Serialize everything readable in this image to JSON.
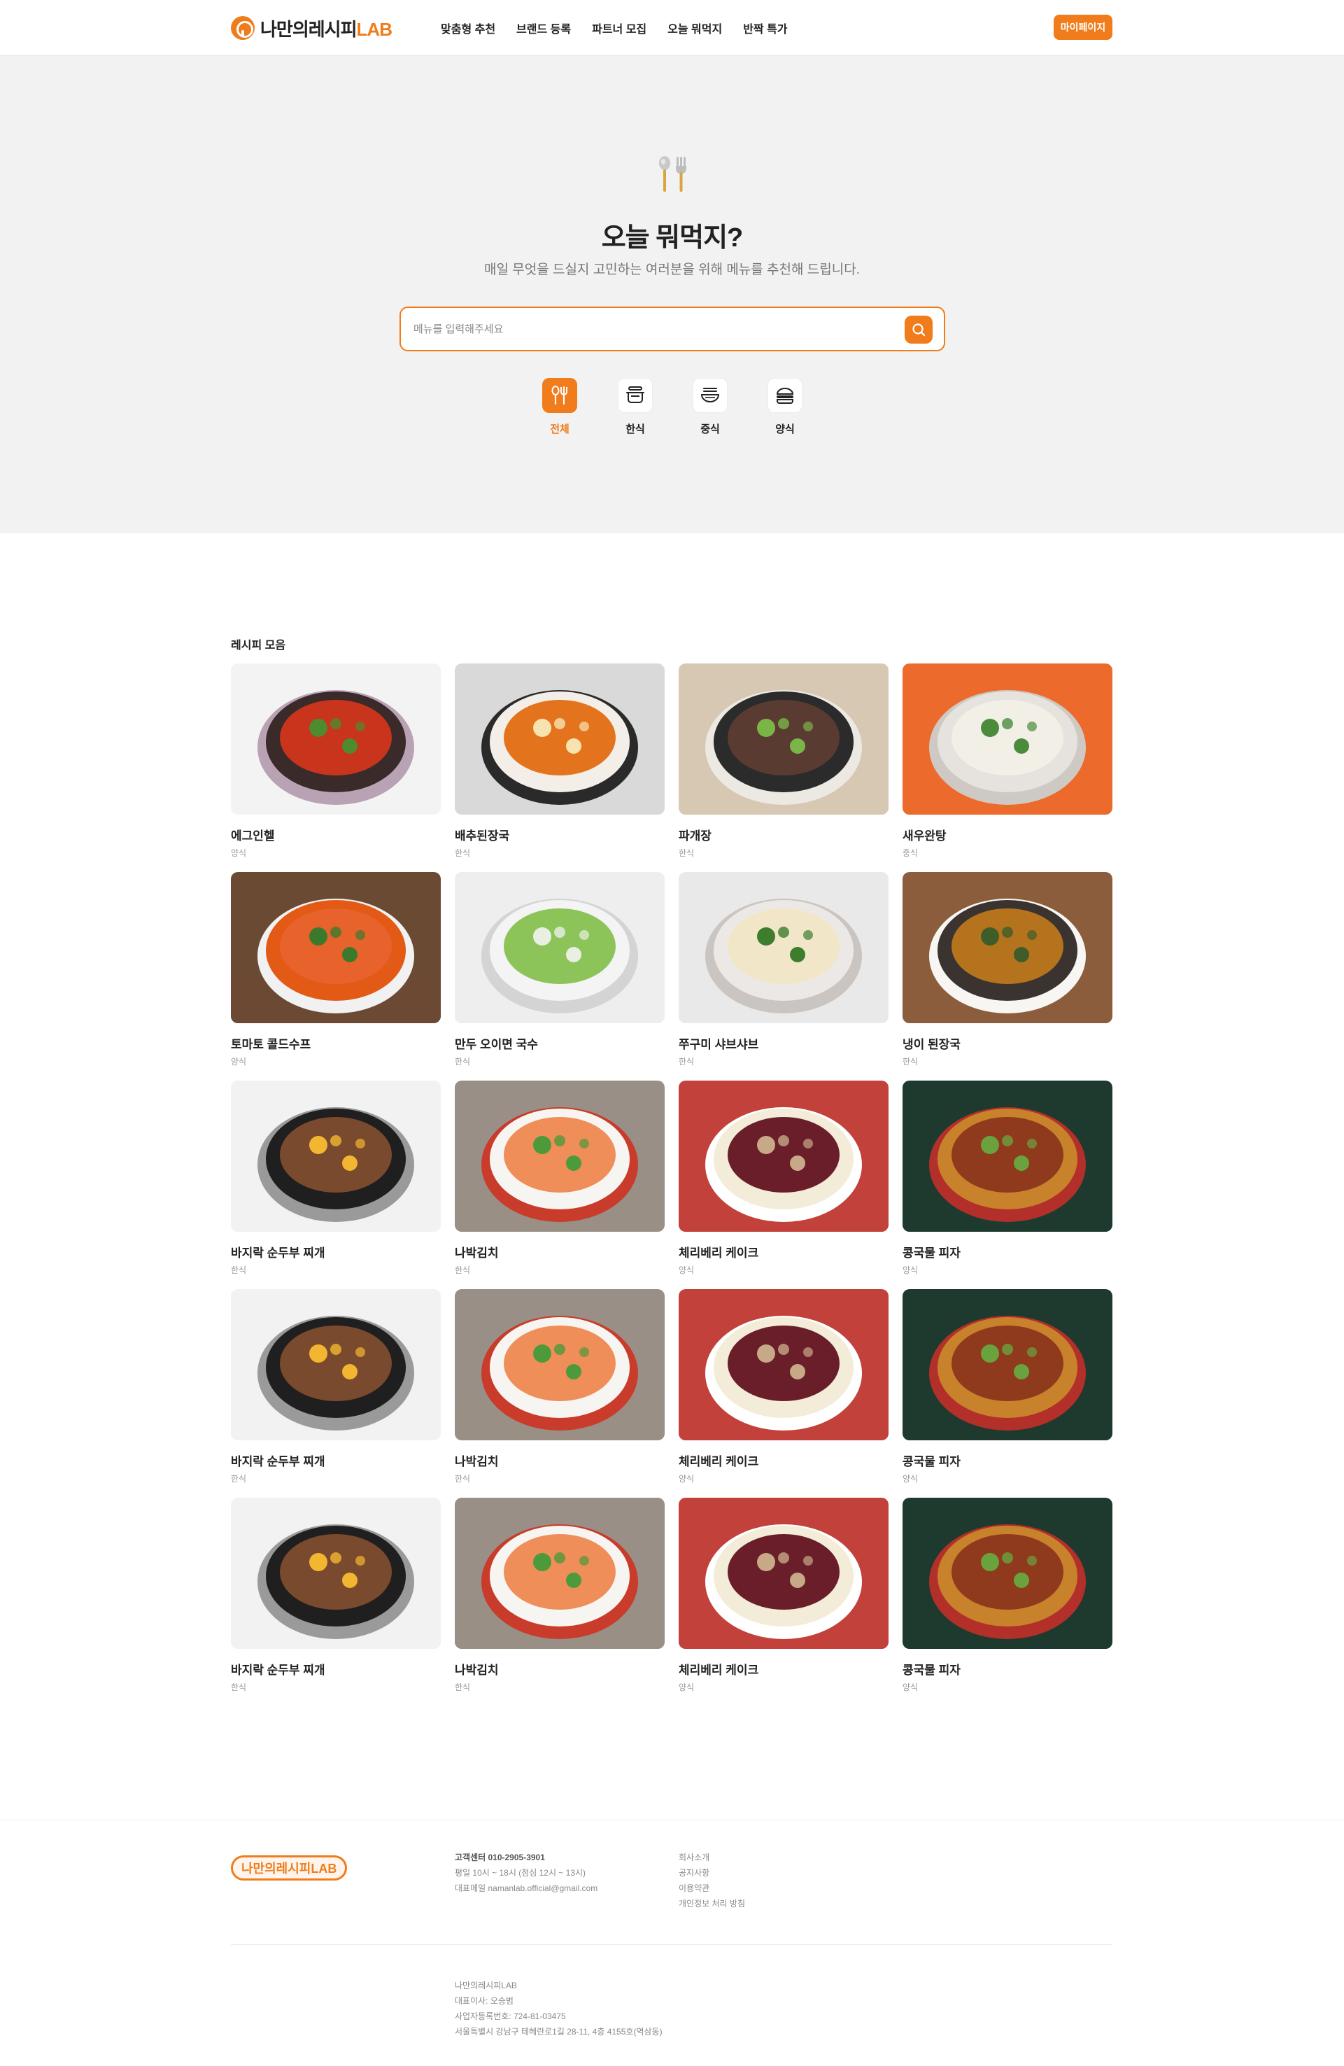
{
  "header": {
    "logo_main": "나만의레시피",
    "logo_lab": "LAB",
    "nav": [
      "맞춤형 추천",
      "브랜드 등록",
      "파트너 모집",
      "오늘 뭐먹지",
      "반짝 특가"
    ],
    "mypage": "마이페이지"
  },
  "hero": {
    "title": "오늘 뭐먹지?",
    "subtitle": "매일 무엇을 드실지 고민하는 여러분을 위해 메뉴를 추천해 드립니다.",
    "search_placeholder": "메뉴를 입력해주세요",
    "categories": [
      {
        "label": "전체",
        "icon": "utensils-icon",
        "active": true
      },
      {
        "label": "한식",
        "icon": "pot-icon",
        "active": false
      },
      {
        "label": "중식",
        "icon": "noodle-bowl-icon",
        "active": false
      },
      {
        "label": "양식",
        "icon": "burger-icon",
        "active": false
      }
    ]
  },
  "recipes": {
    "title": "레시피 모음",
    "items": [
      {
        "name": "에그인헬",
        "category": "양식"
      },
      {
        "name": "배추된장국",
        "category": "한식"
      },
      {
        "name": "파개장",
        "category": "한식"
      },
      {
        "name": "새우완탕",
        "category": "중식"
      },
      {
        "name": "토마토 콜드수프",
        "category": "양식"
      },
      {
        "name": "만두 오이면 국수",
        "category": "한식"
      },
      {
        "name": "쭈구미 샤브샤브",
        "category": "한식"
      },
      {
        "name": "냉이 된장국",
        "category": "한식"
      },
      {
        "name": "바지락 순두부 찌개",
        "category": "한식"
      },
      {
        "name": "나박김치",
        "category": "한식"
      },
      {
        "name": "체리베리 케이크",
        "category": "양식"
      },
      {
        "name": "콩국물 피자",
        "category": "양식"
      },
      {
        "name": "바지락 순두부 찌개",
        "category": "한식"
      },
      {
        "name": "나박김치",
        "category": "한식"
      },
      {
        "name": "체리베리 케이크",
        "category": "양식"
      },
      {
        "name": "콩국물 피자",
        "category": "양식"
      },
      {
        "name": "바지락 순두부 찌개",
        "category": "한식"
      },
      {
        "name": "나박김치",
        "category": "한식"
      },
      {
        "name": "체리베리 케이크",
        "category": "양식"
      },
      {
        "name": "콩국물 피자",
        "category": "양식"
      }
    ]
  },
  "footer": {
    "logo": "나만의레시피LAB",
    "contact": [
      "고객센터 010-2905-3901",
      "평일 10시 ~ 18시 (점심 12시 ~ 13시)",
      "대표메일 namanlab.official@gmail.com"
    ],
    "links": [
      "회사소개",
      "공지사항",
      "이용약관",
      "개인정보 처리 방침"
    ],
    "company": [
      "나만의레시피LAB",
      "대표이사: 오승범",
      "사업자등록번호: 724-81-03475",
      "서울특별시 강남구 테헤란로1길 28-11, 4층 4155호(역삼동)"
    ]
  }
}
